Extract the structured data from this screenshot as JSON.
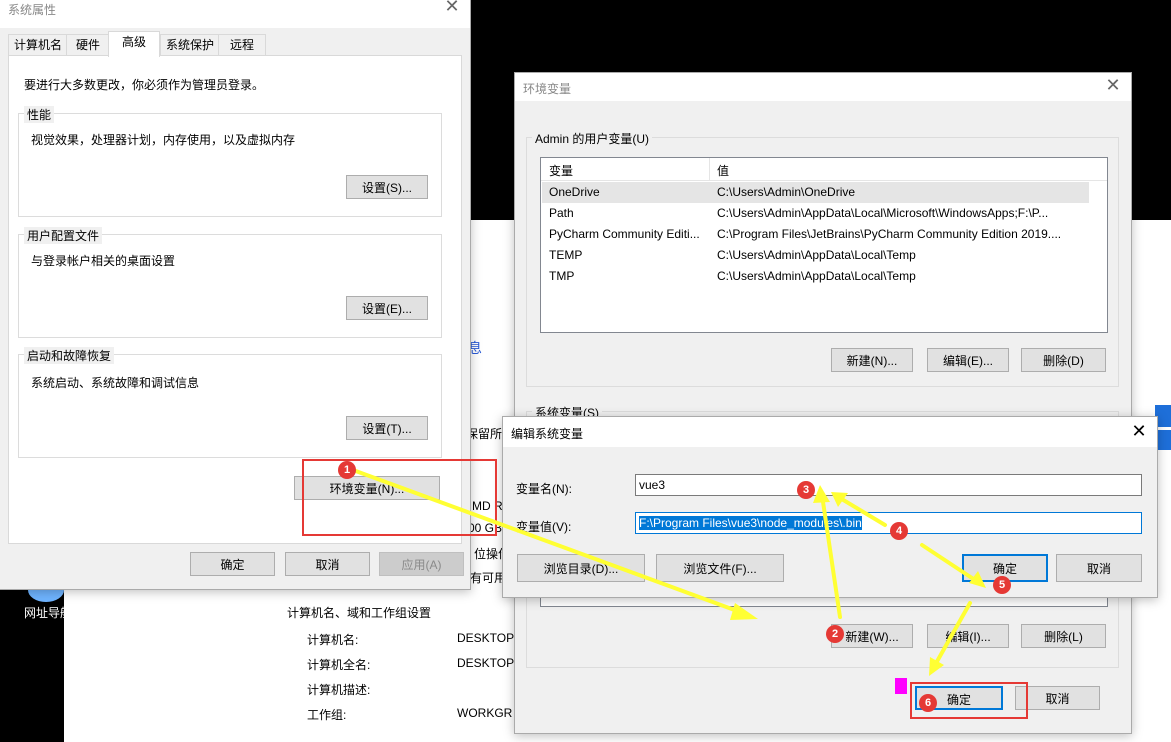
{
  "colors": {
    "accent": "#0078d7",
    "annotation_red": "#e53935",
    "annotation_arrow": "#ffff33",
    "marker": "#ff00ff"
  },
  "background": {
    "desktop_icon_label": "网址导航",
    "link_fragment": "息",
    "reserved_text": "保留所",
    "cpu_text": "MD Ry",
    "ram_text": "00 GB",
    "bits_text": "位操作",
    "avail_text": "有可用",
    "section_title": "计算机名、域和工作组设置",
    "rows": [
      {
        "label": "计算机名:",
        "value": "DESKTOP"
      },
      {
        "label": "计算机全名:",
        "value": "DESKTOP"
      },
      {
        "label": "计算机描述:",
        "value": ""
      },
      {
        "label": "工作组:",
        "value": "WORKGR"
      }
    ]
  },
  "sysprops": {
    "title": "系统属性",
    "tabs": [
      "计算机名",
      "硬件",
      "高级",
      "系统保护",
      "远程"
    ],
    "admin_note": "要进行大多数更改，你必须作为管理员登录。",
    "perf": {
      "label": "性能",
      "desc": "视觉效果，处理器计划，内存使用，以及虚拟内存",
      "button": "设置(S)..."
    },
    "profile": {
      "label": "用户配置文件",
      "desc": "与登录帐户相关的桌面设置",
      "button": "设置(E)..."
    },
    "startup": {
      "label": "启动和故障恢复",
      "desc": "系统启动、系统故障和调试信息",
      "button": "设置(T)..."
    },
    "env_button": "环境变量(N)...",
    "ok": "确定",
    "cancel": "取消",
    "apply": "应用(A)"
  },
  "envdlg": {
    "title": "环境变量",
    "user_group": "Admin 的用户变量(U)",
    "col_var": "变量",
    "col_val": "值",
    "user_vars": [
      {
        "name": "OneDrive",
        "value": "C:\\Users\\Admin\\OneDrive"
      },
      {
        "name": "Path",
        "value": "C:\\Users\\Admin\\AppData\\Local\\Microsoft\\WindowsApps;F:\\P..."
      },
      {
        "name": "PyCharm Community Editi...",
        "value": "C:\\Program Files\\JetBrains\\PyCharm Community Edition 2019...."
      },
      {
        "name": "TEMP",
        "value": "C:\\Users\\Admin\\AppData\\Local\\Temp"
      },
      {
        "name": "TMP",
        "value": "C:\\Users\\Admin\\AppData\\Local\\Temp"
      }
    ],
    "user_new": "新建(N)...",
    "user_edit": "编辑(E)...",
    "user_delete": "删除(D)",
    "sys_group": "系统变量(S)",
    "sys_new": "新建(W)...",
    "sys_edit": "编辑(I)...",
    "sys_delete": "删除(L)",
    "ok": "确定",
    "cancel": "取消"
  },
  "editdlg": {
    "title": "编辑系统变量",
    "name_label": "变量名(N):",
    "name_value": "vue3",
    "value_label": "变量值(V):",
    "value_value": "F:\\Program Files\\vue3\\node_modules\\.bin",
    "browse_dir": "浏览目录(D)...",
    "browse_file": "浏览文件(F)...",
    "ok": "确定",
    "cancel": "取消"
  },
  "badges": [
    "1",
    "2",
    "3",
    "4",
    "5",
    "6"
  ]
}
